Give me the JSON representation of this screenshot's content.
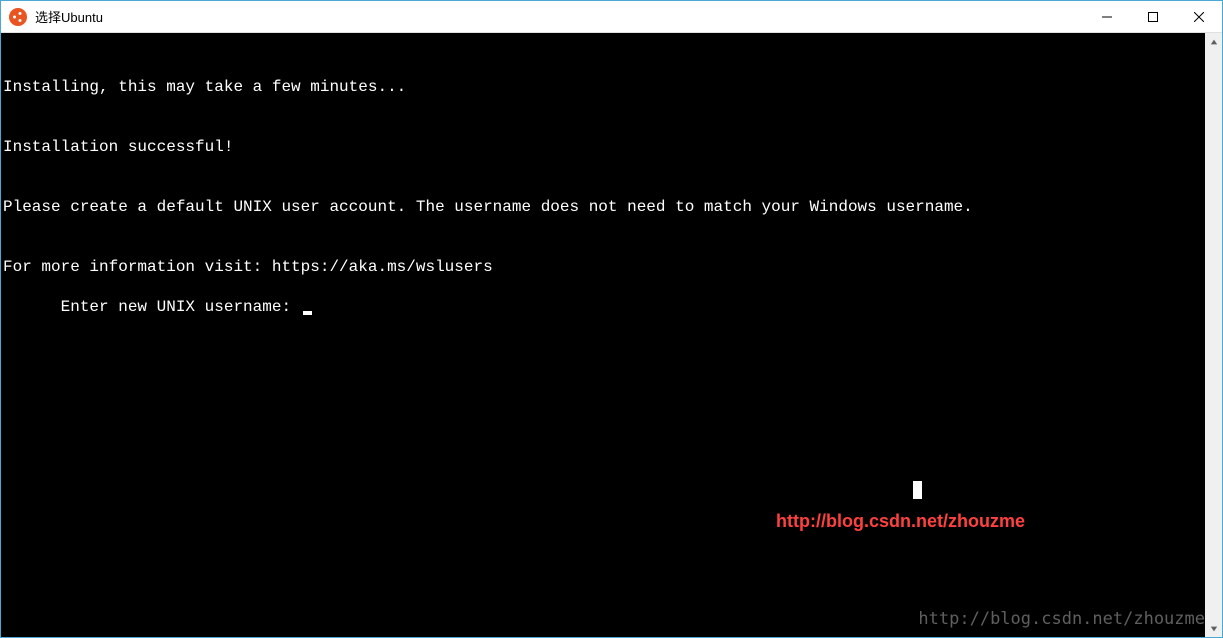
{
  "window": {
    "title": "选择Ubuntu"
  },
  "terminal": {
    "lines": [
      "Installing, this may take a few minutes...",
      "Installation successful!",
      "Please create a default UNIX user account. The username does not need to match your Windows username.",
      "For more information visit: https://aka.ms/wslusers",
      "Enter new UNIX username: "
    ]
  },
  "watermark": {
    "red": "http://blog.csdn.net/zhouzme",
    "gray": "http://blog.csdn.net/zhouzme"
  }
}
